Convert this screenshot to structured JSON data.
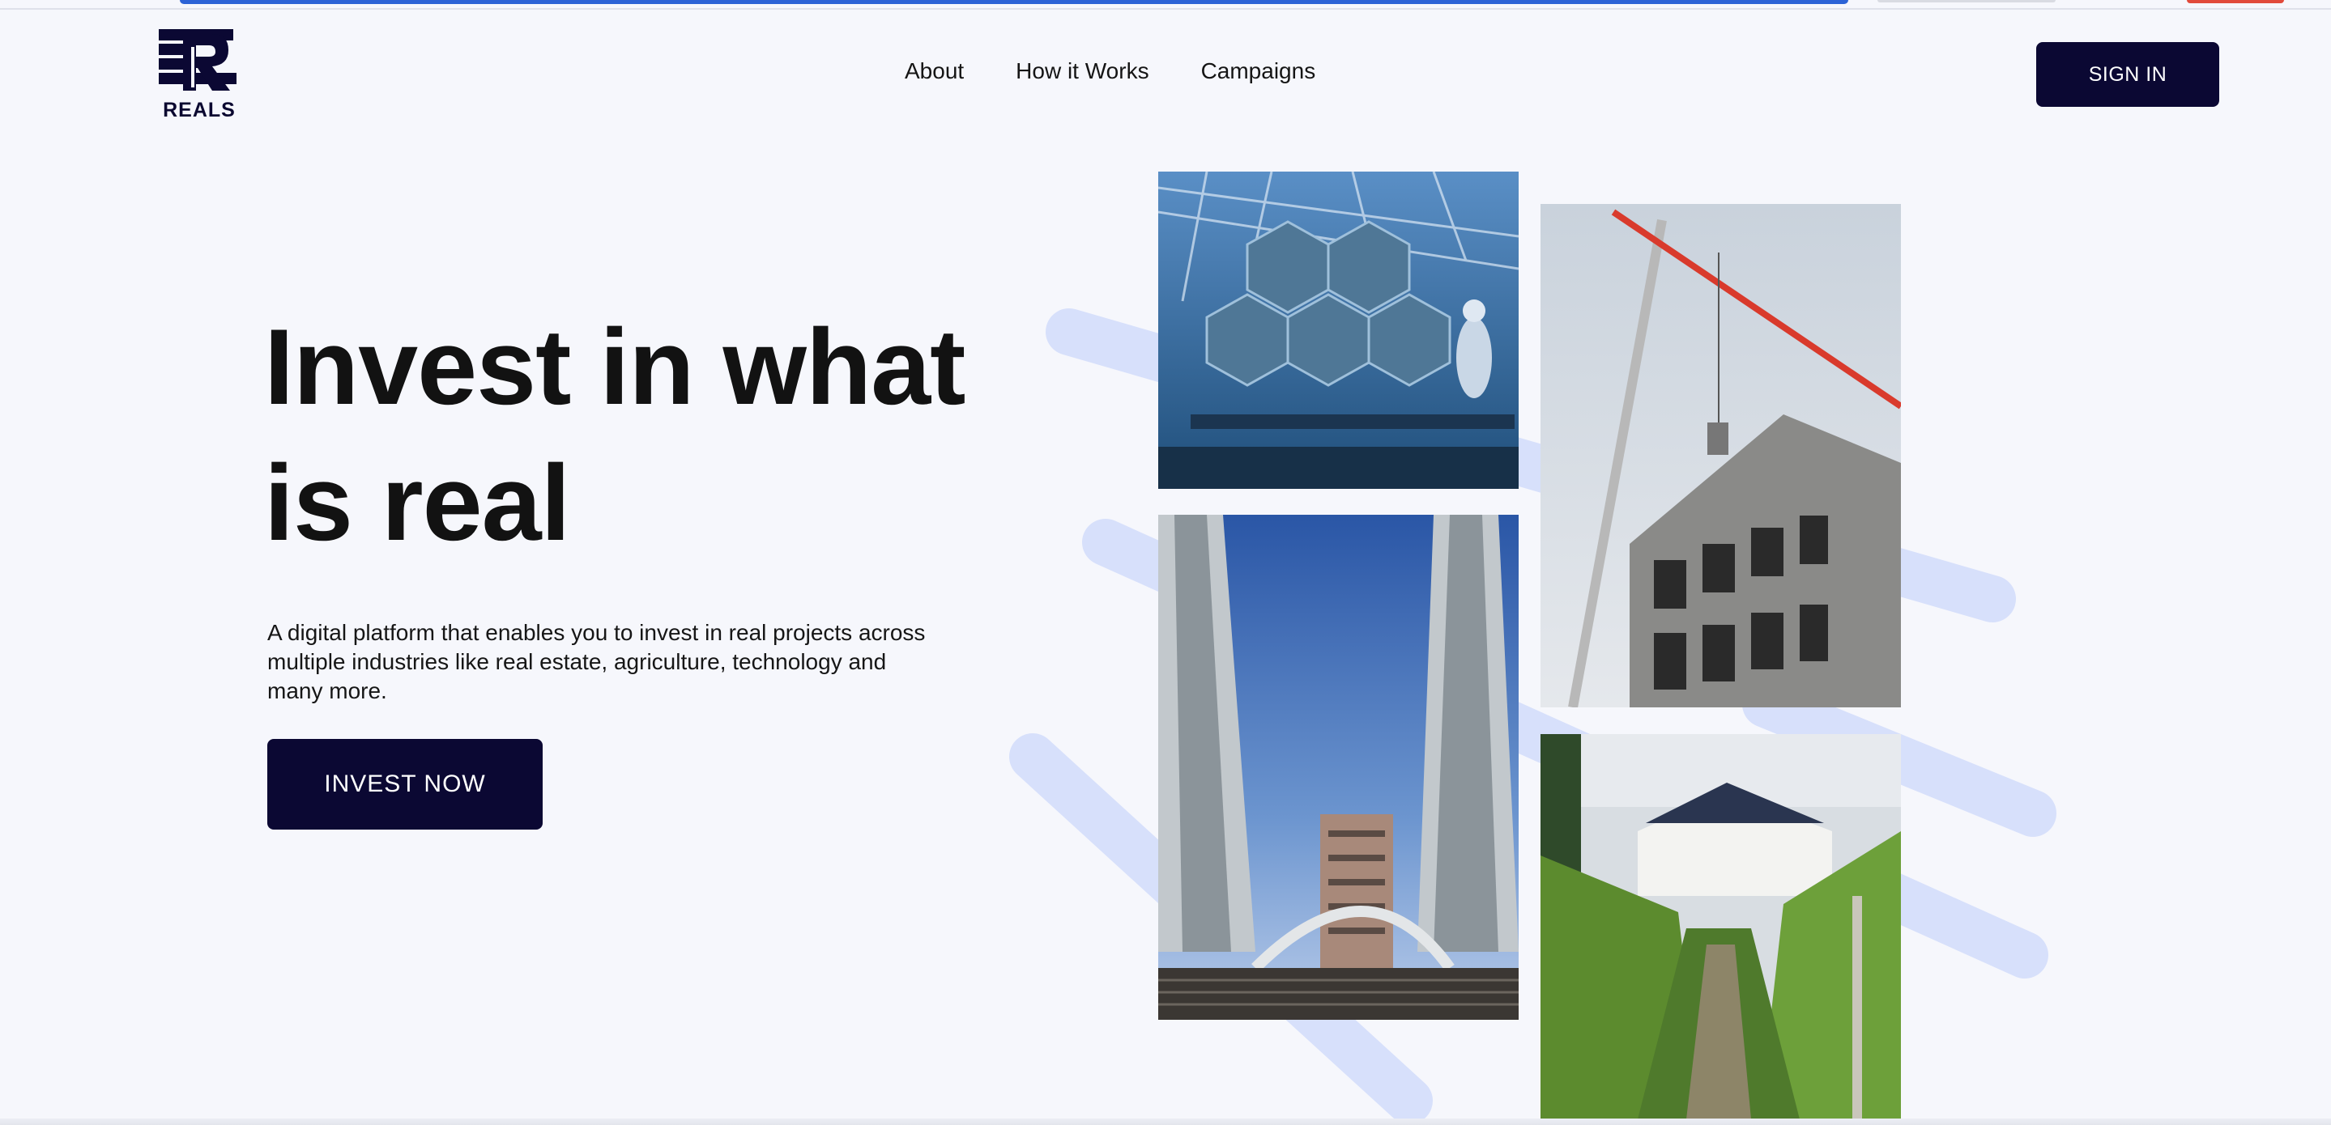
{
  "brand": {
    "name": "REALS",
    "color": "#0b0833"
  },
  "nav": {
    "items": [
      {
        "label": "About"
      },
      {
        "label": "How it Works"
      },
      {
        "label": "Campaigns"
      }
    ],
    "sign_in_label": "SIGN IN"
  },
  "hero": {
    "title_line1": "Invest in what",
    "title_line2": "is real",
    "subtitle": "A digital platform that enables you to invest in real projects across multiple industries like real estate, agriculture, technology and many more.",
    "cta_label": "INVEST NOW"
  },
  "gallery": [
    {
      "name": "telescope-mirror-photo"
    },
    {
      "name": "construction-crane-photo"
    },
    {
      "name": "bridge-towers-photo"
    },
    {
      "name": "vineyard-photo"
    }
  ],
  "colors": {
    "background": "#f6f7fc",
    "stripe": "#d7e0fb",
    "button": "#0b0833"
  }
}
